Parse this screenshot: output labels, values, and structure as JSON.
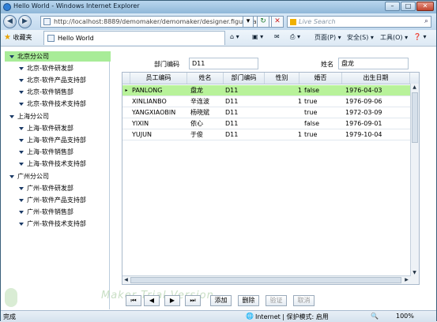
{
  "window": {
    "title": "Hello World - Windows Internet Explorer",
    "minimize_label": "–",
    "maximize_label": "□",
    "close_label": "✕"
  },
  "navbar": {
    "back_label": "◀",
    "forward_label": "▶",
    "address": "http://localhost:8889/demomaker/demomaker/designer.figurePa",
    "address_menu_label": "▾",
    "refresh_label": "↻",
    "stop_label": "✕",
    "search_placeholder": "Live Search",
    "search_icon_label": "⌕"
  },
  "favbar": {
    "favorites_label": "收藏夹",
    "tab_title": "Hello World",
    "home_label": "⌂ ▾",
    "feeds_label": "▣ ▾",
    "mail_label": "✉",
    "print_label": "⎙ ▾",
    "page_menu": "页面(P) ▾",
    "safety_menu": "安全(S) ▾",
    "tools_menu": "工具(O) ▾",
    "help_menu": "❓ ▾"
  },
  "tree": [
    {
      "label": "北京分公司",
      "level": 0,
      "selected": true
    },
    {
      "label": "北京-软件研发部",
      "level": 1
    },
    {
      "label": "北京-软件产品支持部",
      "level": 1
    },
    {
      "label": "北京-软件销售部",
      "level": 1
    },
    {
      "label": "北京-软件技术支持部",
      "level": 1
    },
    {
      "label": "上海分公司",
      "level": 0
    },
    {
      "label": "上海-软件研发部",
      "level": 1
    },
    {
      "label": "上海-软件产品支持部",
      "level": 1
    },
    {
      "label": "上海-软件销售部",
      "level": 1
    },
    {
      "label": "上海-软件技术支持部",
      "level": 1
    },
    {
      "label": "广州分公司",
      "level": 0
    },
    {
      "label": "广州-软件研发部",
      "level": 1
    },
    {
      "label": "广州-软件产品支持部",
      "level": 1
    },
    {
      "label": "广州-软件销售部",
      "level": 1
    },
    {
      "label": "广州-软件技术支持部",
      "level": 1
    }
  ],
  "form": {
    "dept_code_label": "部门编码",
    "dept_code_value": "D11",
    "name_label": "姓名",
    "name_value": "盘龙"
  },
  "grid": {
    "columns": [
      "员工编码",
      "姓名",
      "部门编码",
      "性别",
      "婚否",
      "出生日期"
    ],
    "rows": [
      {
        "code": "PANLONG",
        "name": "盘龙",
        "dept": "D11",
        "gender": "1",
        "married": "false",
        "birth": "1976-04-03",
        "selected": true
      },
      {
        "code": "XINLIANBO",
        "name": "辛连波",
        "dept": "D11",
        "gender": "1",
        "married": "true",
        "birth": "1976-09-06"
      },
      {
        "code": "YANGXIAOBIN",
        "name": "杨晓斌",
        "dept": "D11",
        "gender": "",
        "married": "true",
        "birth": "1972-03-09"
      },
      {
        "code": "YIXIN",
        "name": "依心",
        "dept": "D11",
        "gender": "",
        "married": "false",
        "birth": "1976-09-01"
      },
      {
        "code": "YUJUN",
        "name": "于俊",
        "dept": "D11",
        "gender": "1",
        "married": "true",
        "birth": "1979-10-04"
      }
    ],
    "row_indicator": "▸",
    "scroll_up": "▲",
    "scroll_down": "▼",
    "scroll_left": "◀",
    "scroll_right": "▶"
  },
  "pager": {
    "first": "⏮",
    "prev": "◀",
    "next": "▶",
    "last": "⏭",
    "add": "添加",
    "delete": "删除",
    "validate": "验证",
    "cancel": "取消"
  },
  "watermark": "Maker Trial Version",
  "status": {
    "done": "完成",
    "zone": "Internet | 保护模式: 启用",
    "zoom": "100%"
  }
}
